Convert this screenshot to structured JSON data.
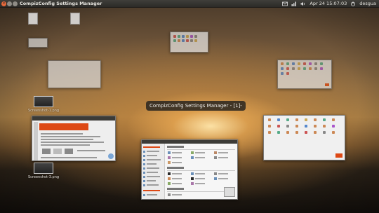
{
  "panel": {
    "app_title": "CompizConfig Settings Manager",
    "datetime": "Apr 24 15:07:03",
    "user": "desgua",
    "icons": [
      "mail-icon",
      "network-icon",
      "volume-icon",
      "power-icon"
    ]
  },
  "desktop": {
    "icons": [
      {
        "label": "Screenshot-1.png",
        "kind": "image"
      },
      {
        "label": "Screenshot-3.png",
        "kind": "image"
      }
    ]
  },
  "tooltip": {
    "text": "CompizConfig Settings Manager - [1]-"
  },
  "colors": {
    "accent": "#dd4814",
    "panel": "#3c3b37",
    "close_button": "#e5683b"
  }
}
